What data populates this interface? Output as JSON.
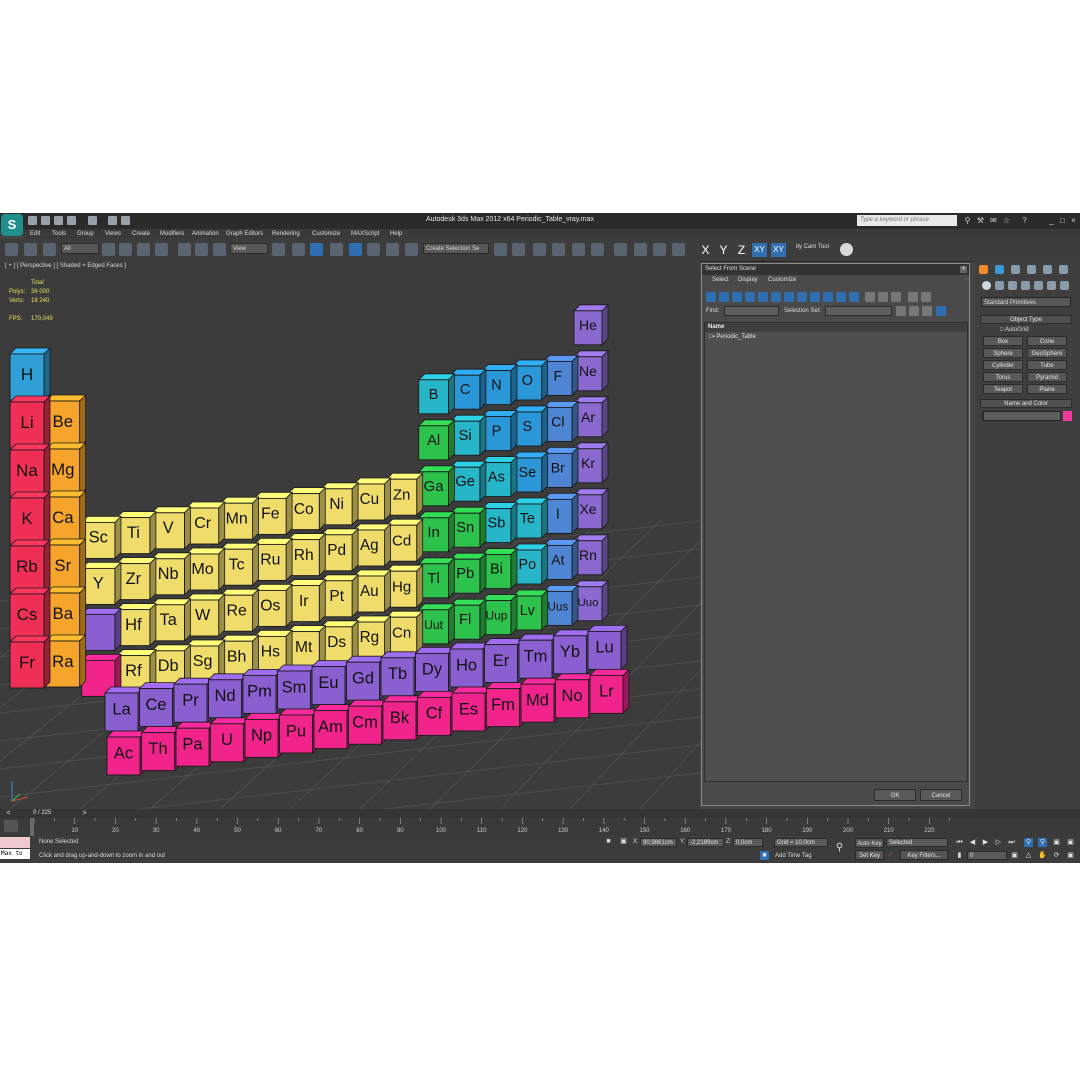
{
  "titlebar": {
    "title": "Autodesk 3ds Max  2012 x64     Periodic_Table_vray.max",
    "search_placeholder": "Type a keyword or phrase"
  },
  "menu": [
    "Edit",
    "Tools",
    "Group",
    "Views",
    "Create",
    "Modifiers",
    "Animation",
    "Graph Editors",
    "Rendering",
    "Customize",
    "MAXScript",
    "Help"
  ],
  "toolbar": {
    "filter": "All",
    "refcoord": "View",
    "create_selection_set": "Create Selection Se",
    "axes": [
      "X",
      "Y",
      "Z",
      "XY",
      "XY"
    ],
    "cam_tool": "ity Cam Tool"
  },
  "viewport": {
    "label": "[ + ] [ Perspective ] [ Shaded + Edged Faces ]",
    "stats": {
      "total": "Total",
      "polys_label": "Polys:",
      "polys": "36 000",
      "verts_label": "Verts:",
      "verts": "18 240",
      "fps_label": "FPS:",
      "fps": "170,049"
    }
  },
  "periodic_table": {
    "main": [
      [
        "H",
        "",
        "",
        "",
        "",
        "",
        "",
        "",
        "",
        "",
        "",
        "",
        "",
        "",
        "",
        "",
        "",
        "He"
      ],
      [
        "Li",
        "Be",
        "",
        "",
        "",
        "",
        "",
        "",
        "",
        "",
        "",
        "",
        "B",
        "C",
        "N",
        "O",
        "F",
        "Ne"
      ],
      [
        "Na",
        "Mg",
        "",
        "",
        "",
        "",
        "",
        "",
        "",
        "",
        "",
        "",
        "Al",
        "Si",
        "P",
        "S",
        "Cl",
        "Ar"
      ],
      [
        "K",
        "Ca",
        "Sc",
        "Ti",
        "V",
        "Cr",
        "Mn",
        "Fe",
        "Co",
        "Ni",
        "Cu",
        "Zn",
        "Ga",
        "Ge",
        "As",
        "Se",
        "Br",
        "Kr"
      ],
      [
        "Rb",
        "Sr",
        "Y",
        "Zr",
        "Nb",
        "Mo",
        "Tc",
        "Ru",
        "Rh",
        "Pd",
        "Ag",
        "Cd",
        "In",
        "Sn",
        "Sb",
        "Te",
        "I",
        "Xe"
      ],
      [
        "Cs",
        "Ba",
        "",
        "Hf",
        "Ta",
        "W",
        "Re",
        "Os",
        "Ir",
        "Pt",
        "Au",
        "Hg",
        "Tl",
        "Pb",
        "Bi",
        "Po",
        "At",
        "Rn"
      ],
      [
        "Fr",
        "Ra",
        "",
        "Rf",
        "Db",
        "Sg",
        "Bh",
        "Hs",
        "Mt",
        "Ds",
        "Rg",
        "Cn",
        "Uut",
        "Fl",
        "Uup",
        "Lv",
        "Uus",
        "Uuo"
      ]
    ],
    "lanthanides": [
      "La",
      "Ce",
      "Pr",
      "Nd",
      "Pm",
      "Sm",
      "Eu",
      "Gd",
      "Tb",
      "Dy",
      "Ho",
      "Er",
      "Tm",
      "Yb",
      "Lu"
    ],
    "actinides": [
      "Ac",
      "Th",
      "Pa",
      "U",
      "Np",
      "Pu",
      "Am",
      "Cm",
      "Bk",
      "Cf",
      "Es",
      "Fm",
      "Md",
      "No",
      "Lr"
    ],
    "colors": {
      "hydrogen": "#2f9fd6",
      "alkali": "#ef2f55",
      "alkaline": "#f5a52b",
      "transition": "#efdc6a",
      "post": "#2cc24c",
      "metalloid": "#27b6c9",
      "nonmetal": "#2a97d8",
      "halogen": "#4f86d4",
      "noble": "#8b6ad0",
      "lanthanide": "#8a5fd0",
      "actinide": "#f0248b"
    }
  },
  "select_dialog": {
    "title": "Select From Scene",
    "menus": [
      "Select",
      "Display",
      "Customize"
    ],
    "find_label": "Find:",
    "selection_set_label": "Selection Set:",
    "column_name": "Name",
    "items": [
      "Periodic_Table"
    ],
    "ok": "OK",
    "cancel": "Cancel"
  },
  "command_panel": {
    "category": "Standard Primitives",
    "object_type_title": "Object Type",
    "autogrid": "AutoGrid",
    "buttons": [
      "Box",
      "Cone",
      "Sphere",
      "GeoSphere",
      "Cylinder",
      "Tube",
      "Torus",
      "Pyramid",
      "Teapot",
      "Plane"
    ],
    "name_color_title": "Name and Color",
    "object_color": "#ee3a97"
  },
  "timeline": {
    "frame": "0 / 225",
    "ticks": [
      "10",
      "20",
      "30",
      "40",
      "50",
      "60",
      "70",
      "80",
      "90",
      "100",
      "110",
      "120",
      "130",
      "140",
      "150",
      "160",
      "170",
      "180",
      "190",
      "200",
      "210",
      "220"
    ]
  },
  "status": {
    "maxscript": "Max to",
    "selection": "None Selected",
    "prompt": "Click and drag up-and-down to zoom in and out",
    "x_label": "X:",
    "x": "90,9861cm",
    "y_label": "Y:",
    "y": "-2,2189cm",
    "z_label": "Z:",
    "z": "0,0cm",
    "grid": "Grid = 10,0cm",
    "add_time_tag": "Add Time Tag",
    "auto_key": "Auto Key",
    "set_key": "Set Key",
    "selected": "Selected",
    "key_filters": "Key Filters...",
    "current_frame": "0"
  }
}
